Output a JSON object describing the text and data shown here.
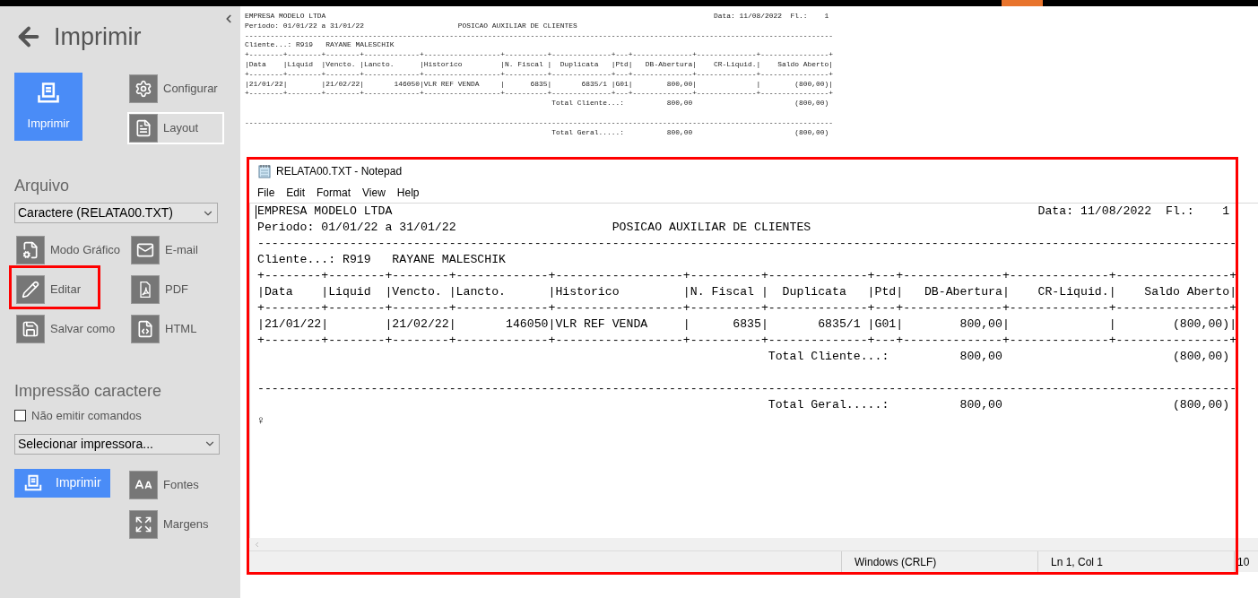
{
  "sidebar": {
    "title": "Imprimir",
    "print_button": {
      "label": "Imprimir"
    },
    "side_actions": [
      {
        "kind": "settings",
        "label": "Configurar",
        "focused": false
      },
      {
        "kind": "layout",
        "label": "Layout",
        "focused": true
      }
    ],
    "file_section": {
      "heading": "Arquivo",
      "format_select": {
        "value": "Caractere  (RELATA00.TXT)"
      },
      "actions": [
        {
          "kind": "graphic-mode",
          "label": "Modo Gráfico",
          "highlighted": false
        },
        {
          "kind": "email",
          "label": "E-mail",
          "highlighted": false
        },
        {
          "kind": "edit",
          "label": "Editar",
          "highlighted": true
        },
        {
          "kind": "pdf",
          "label": "PDF",
          "highlighted": false
        },
        {
          "kind": "save",
          "label": "Salvar como",
          "highlighted": false
        },
        {
          "kind": "html",
          "label": "HTML",
          "highlighted": false
        }
      ]
    },
    "char_section": {
      "heading": "Impressão caractere",
      "checkbox": {
        "label": "Não emitir comandos",
        "checked": false
      },
      "printer_select": {
        "value": "Selecionar impressora..."
      },
      "print_button": {
        "label": "Imprimir"
      },
      "actions": [
        {
          "kind": "fonts",
          "label": "Fontes",
          "highlighted": false
        },
        {
          "kind": "margins",
          "label": "Margens",
          "highlighted": false
        }
      ]
    }
  },
  "preview": {
    "content": "EMPRESA MODELO LTDA                                                                                           Data: 11/08/2022  Fl.:    1\nPeriodo: 01/01/22 a 31/01/22                      POSICAO AUXILIAR DE CLIENTES\n------------------------------------------------------------------------------------------------------------------------------------------\nCliente...: R919   RAYANE MALESCHIK\n+--------+--------+--------+-------------+------------------+----------+--------------+---+--------------+--------------+----------------+\n|Data    |Liquid  |Vencto. |Lancto.      |Historico         |N. Fiscal |  Duplicata   |Ptd|   DB-Abertura|    CR-Liquid.|    Saldo Aberto|\n+--------+--------+--------+-------------+------------------+----------+--------------+---+--------------+--------------+----------------+\n|21/01/22|        |21/02/22|       146050|VLR REF VENDA     |      6835|       6835/1 |G01|        800,00|              |        (800,00)|\n+--------+--------+--------+-------------+------------------+----------+--------------+---+--------------+--------------+----------------+\n                                                                        Total Cliente...:          800,00                        (800,00)\n\n------------------------------------------------------------------------------------------------------------------------------------------\n                                                                        Total Geral.....:          800,00                        (800,00)"
  },
  "notepad": {
    "title": "RELATA00.TXT - Notepad",
    "highlighted": true,
    "menu": [
      "File",
      "Edit",
      "Format",
      "View",
      "Help"
    ],
    "content": "EMPRESA MODELO LTDA                                                                                           Data: 11/08/2022  Fl.:    1\nPeriodo: 01/01/22 a 31/01/22                      POSICAO AUXILIAR DE CLIENTES\n------------------------------------------------------------------------------------------------------------------------------------------\nCliente...: R919   RAYANE MALESCHIK\n+--------+--------+--------+-------------+------------------+----------+--------------+---+--------------+--------------+----------------+\n|Data    |Liquid  |Vencto. |Lancto.      |Historico         |N. Fiscal |  Duplicata   |Ptd|   DB-Abertura|    CR-Liquid.|    Saldo Aberto|\n+--------+--------+--------+-------------+------------------+----------+--------------+---+--------------+--------------+----------------+\n|21/01/22|        |21/02/22|       146050|VLR REF VENDA     |      6835|       6835/1 |G01|        800,00|              |        (800,00)|\n+--------+--------+--------+-------------+------------------+----------+--------------+---+--------------+--------------+----------------+\n                                                                        Total Cliente...:          800,00                        (800,00)\n\n------------------------------------------------------------------------------------------------------------------------------------------\n                                                                        Total Geral.....:          800,00                        (800,00)\n♀",
    "status_bar": [
      "Windows (CRLF)",
      "Ln 1, Col 1",
      "10"
    ]
  }
}
